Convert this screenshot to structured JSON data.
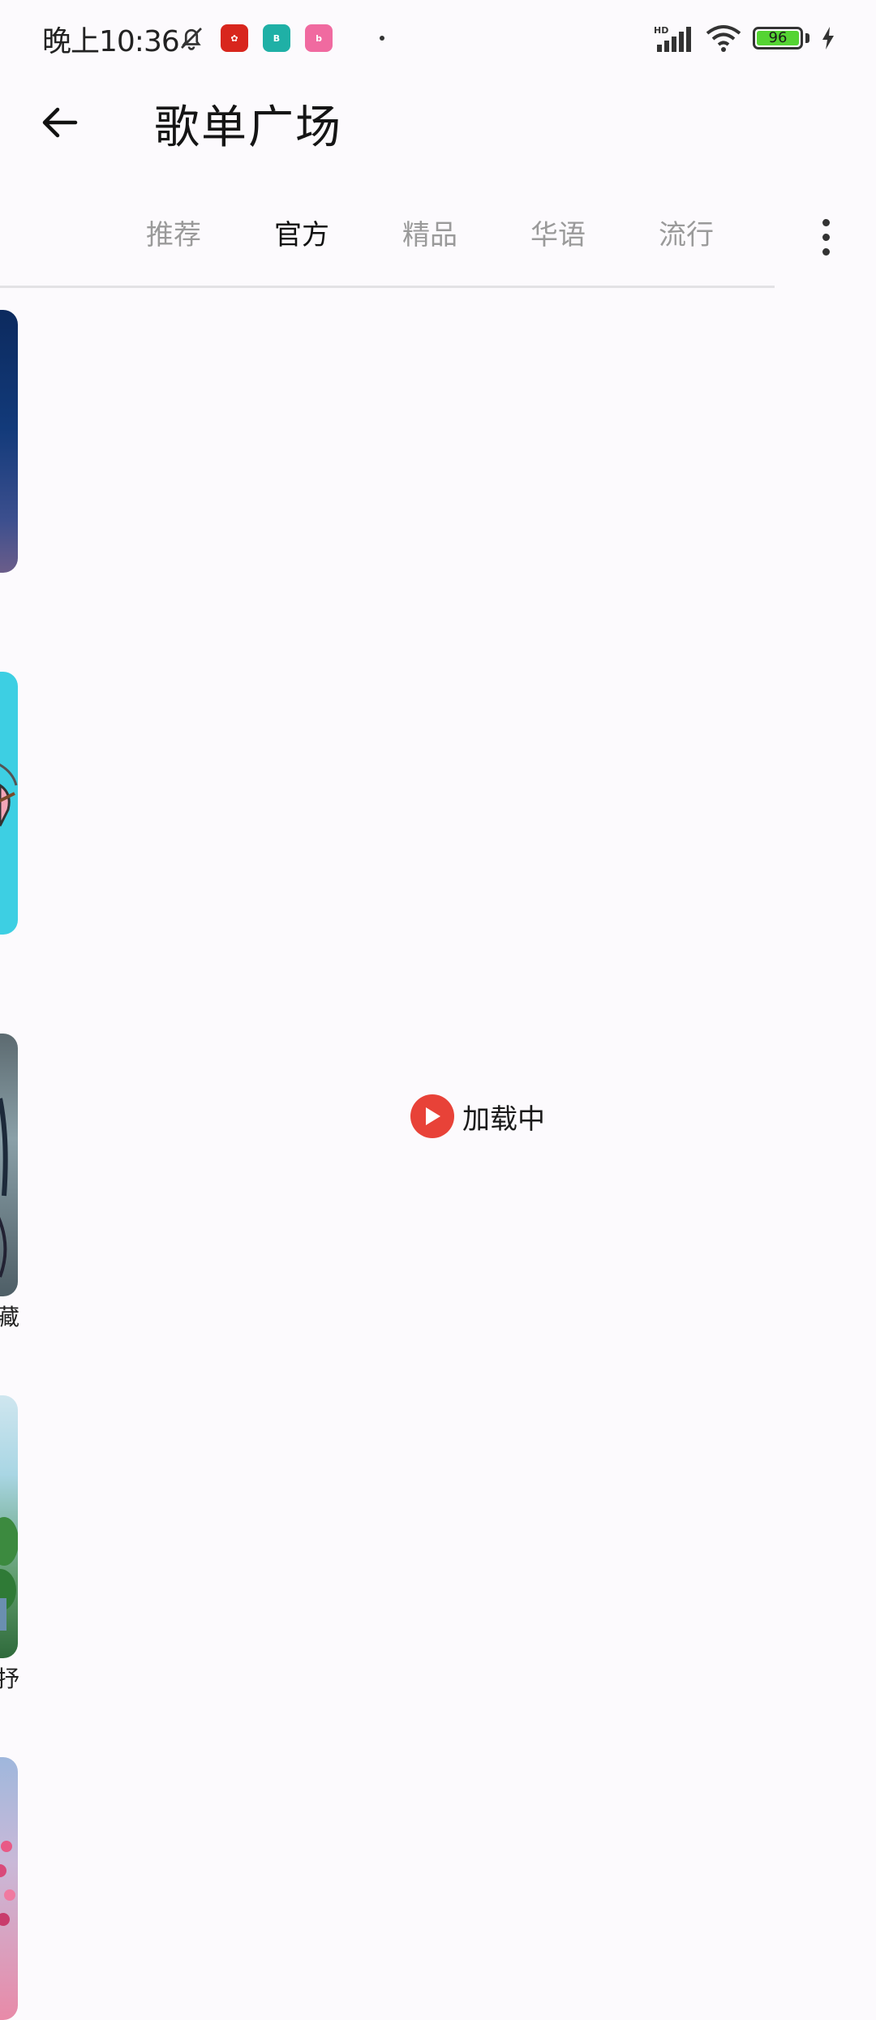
{
  "status_bar": {
    "time": "晚上10:36",
    "battery_level": "96",
    "network": "HD"
  },
  "header": {
    "title": "歌单广场"
  },
  "tabs": [
    {
      "label": "推荐",
      "active": false
    },
    {
      "label": "官方",
      "active": true
    },
    {
      "label": "精品",
      "active": false
    },
    {
      "label": "华语",
      "active": false
    },
    {
      "label": "流行",
      "active": false
    }
  ],
  "cards": [
    {
      "caption": ""
    },
    {
      "caption": ""
    },
    {
      "caption": "藏"
    },
    {
      "caption": "抒"
    },
    {
      "caption": ""
    }
  ],
  "loading": {
    "text": "加载中"
  },
  "colors": {
    "background": "#fcfafd",
    "accent": "#e84238",
    "active_tab": "#111111",
    "inactive_tab": "#9a9a9a"
  }
}
